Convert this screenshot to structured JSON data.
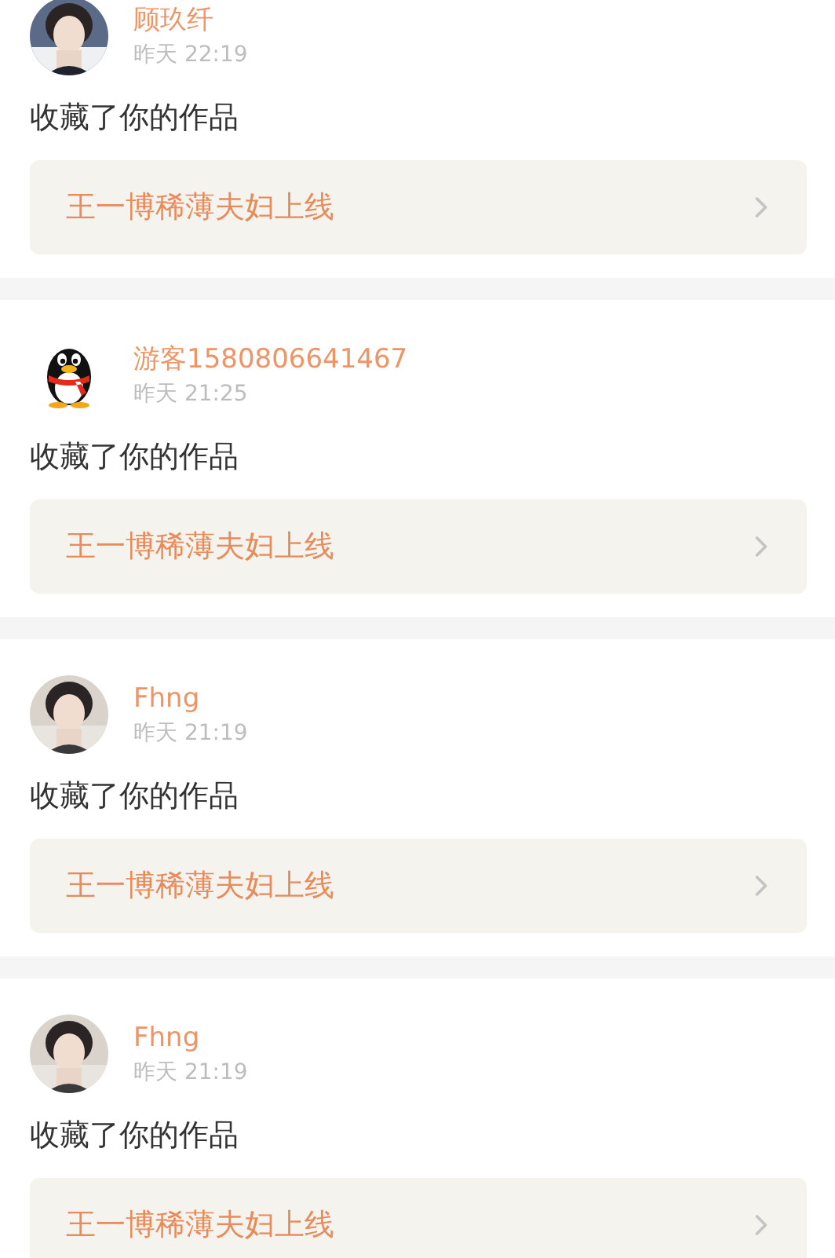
{
  "notifications": [
    {
      "user": "顾玖纤",
      "time": "昨天 22:19",
      "action": "收藏了你的作品",
      "work": "王一博稀薄夫妇上线"
    },
    {
      "avatar": {
        "kind": "penguin"
      },
      "user": "游客1580806641467",
      "time": "昨天 21:25",
      "action": "收藏了你的作品",
      "work": "王一博稀薄夫妇上线"
    },
    {
      "user": "Fhng",
      "time": "昨天 21:19",
      "action": "收藏了你的作品",
      "work": "王一博稀薄夫妇上线"
    },
    {
      "user": "Fhng",
      "time": "昨天 21:19",
      "action": "收藏了你的作品",
      "work": "王一博稀薄夫妇上线"
    }
  ]
}
